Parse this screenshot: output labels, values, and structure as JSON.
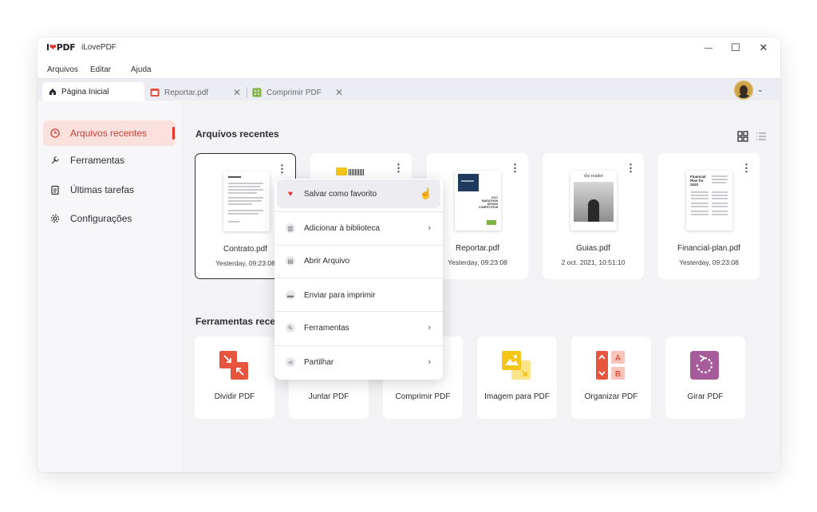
{
  "app": {
    "logo_prefix": "I",
    "logo_suffix": "PDF",
    "title": "iLovePDF"
  },
  "window_controls": {
    "minimize": "—",
    "maximize": "☐",
    "close": "✕"
  },
  "menu": [
    "Arquivos",
    "Editar",
    "Ajuda"
  ],
  "tabs": [
    {
      "label": "Página Inicial",
      "icon": "home-icon",
      "active": true
    },
    {
      "label": "Reportar.pdf",
      "icon": "pdf-file-icon",
      "active": false
    },
    {
      "label": "Comprimir PDF",
      "icon": "compress-icon",
      "active": false
    }
  ],
  "sidebar": {
    "items": [
      {
        "label": "Arquivos recentes",
        "icon": "clock-icon",
        "active": true
      },
      {
        "label": "Ferramentas",
        "icon": "wrench-icon",
        "active": false
      },
      {
        "label": "Últimas tarefas",
        "icon": "clipboard-icon",
        "active": false
      },
      {
        "label": "Configurações",
        "icon": "gear-icon",
        "active": false
      }
    ]
  },
  "recent": {
    "title": "Arquivos recentes",
    "files": [
      {
        "name": "Contrato.pdf",
        "date": "Yesterday, 09:23:08"
      },
      {
        "name": "",
        "date": ""
      },
      {
        "name": "Reportar.pdf",
        "date": "Yesterday, 09:23:08"
      },
      {
        "name": "Guias.pdf",
        "date": "2 oct. 2021, 10:51:10"
      },
      {
        "name": "Financial-plan.pdf",
        "date": "Yesterday, 09:23:08"
      }
    ],
    "thumb_texts": {
      "report": [
        "ECO",
        "MARATHON",
        "DESIGN",
        "COMPETITION"
      ],
      "reader": "the reader",
      "financial": [
        "Financial",
        "Plan for",
        "2020"
      ]
    }
  },
  "tools": {
    "title": "Ferramentas rece",
    "items": [
      {
        "label": "Dividir PDF",
        "icon": "split-icon",
        "color": "#e8553e"
      },
      {
        "label": "Juntar PDF",
        "icon": "merge-icon",
        "color": "#e8553e"
      },
      {
        "label": "Comprimir PDF",
        "icon": "compress-icon",
        "color": "#7cb342"
      },
      {
        "label": "Imagem para PDF",
        "icon": "image-icon",
        "color": "#f5c518"
      },
      {
        "label": "Organizar PDF",
        "icon": "organize-icon",
        "color": "#e8553e"
      },
      {
        "label": "Girar PDF",
        "icon": "rotate-icon",
        "color": "#a65c9a"
      }
    ],
    "organize_letters": [
      "A",
      "B"
    ]
  },
  "context_menu": {
    "items": [
      {
        "label": "Salvar como favorito",
        "icon": "heart-icon",
        "submenu": false,
        "hovered": true
      },
      {
        "label": "Adicionar à biblioteca",
        "icon": "library-icon",
        "submenu": true
      },
      {
        "label": "Abrir Arquivo",
        "icon": "file-icon",
        "submenu": false
      },
      {
        "label": "Enviar para imprimir",
        "icon": "printer-icon",
        "submenu": false
      },
      {
        "label": "Ferramentas",
        "icon": "wrench-icon",
        "submenu": true
      },
      {
        "label": "Partilhar",
        "icon": "share-icon",
        "submenu": true
      }
    ]
  },
  "colors": {
    "accent": "#e5322d",
    "active_bg": "#fbe1de"
  }
}
